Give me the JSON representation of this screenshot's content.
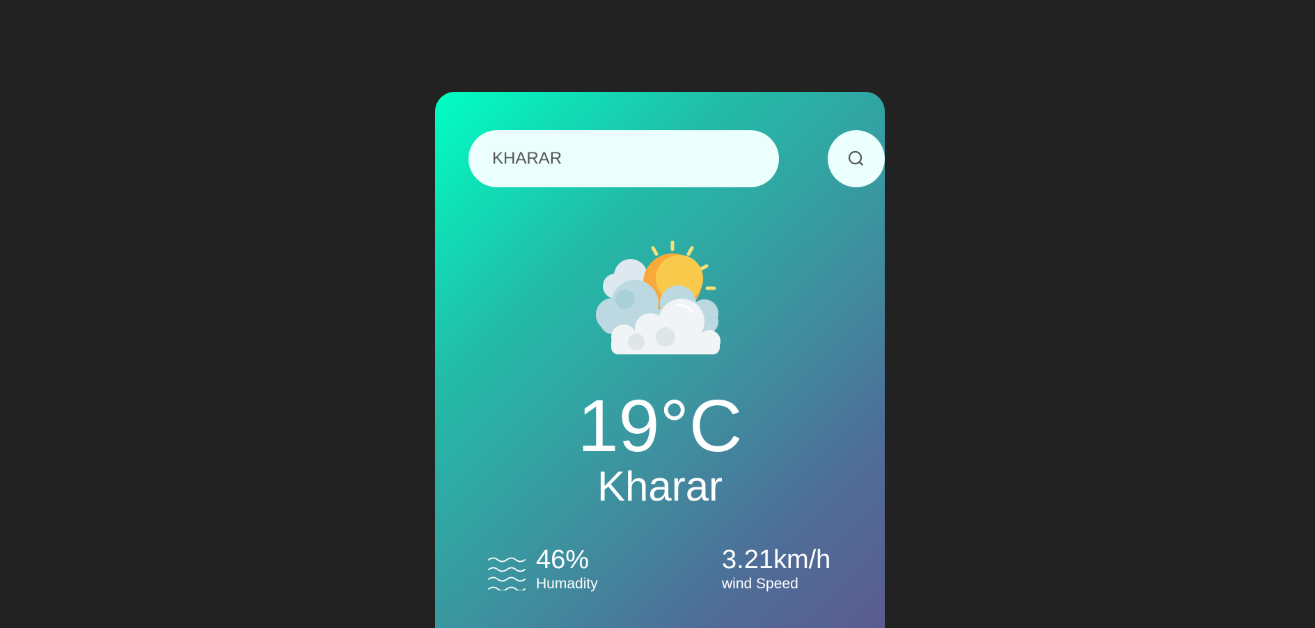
{
  "search": {
    "value": "KHARAR",
    "button_icon": "search-icon"
  },
  "weather": {
    "icon": "partly-cloudy-sun-icon",
    "temperature": "19°C",
    "city": "Kharar"
  },
  "details": {
    "humidity": {
      "icon": "humidity-waves-icon",
      "value": "46%",
      "label": "Humadity"
    },
    "wind": {
      "value": "3.21km/h",
      "label": "wind Speed"
    }
  },
  "colors": {
    "page_background": "#222222",
    "card_gradient_start": "#00ffc3",
    "card_gradient_end": "#5b5b8f",
    "input_background": "#ebfffc",
    "text": "#ffffff"
  }
}
